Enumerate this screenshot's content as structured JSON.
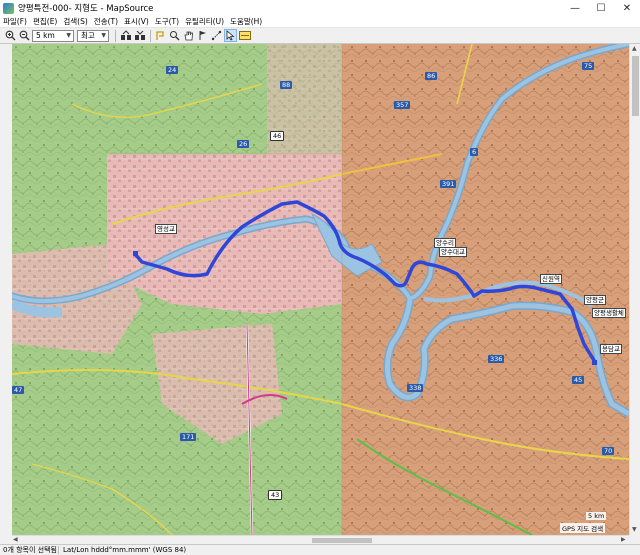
{
  "window": {
    "title": "양평특전-000- 지형도 - MapSource",
    "minimize_glyph": "—",
    "maximize_glyph": "☐",
    "close_glyph": "✕"
  },
  "menu": [
    {
      "label": "파일(F)"
    },
    {
      "label": "편집(E)"
    },
    {
      "label": "검색(S)"
    },
    {
      "label": "전송(T)"
    },
    {
      "label": "표시(V)"
    },
    {
      "label": "도구(T)"
    },
    {
      "label": "유틸리티(U)"
    },
    {
      "label": "도움말(H)"
    }
  ],
  "toolbar": {
    "zoom_level": "5 km",
    "detail_level": "최고",
    "icons": [
      "zoom-in-icon",
      "zoom-out-icon",
      "send-to-device-icon",
      "receive-from-device-icon",
      "route-tool-icon",
      "zoom-tool-icon",
      "hand-tool-icon",
      "flag-tool-icon",
      "measure-tool-icon",
      "select-tool-icon",
      "map-legend-icon"
    ]
  },
  "map": {
    "places": [
      {
        "label": "영성교"
      },
      {
        "label": "양수리"
      },
      {
        "label": "양수대교"
      },
      {
        "label": "신원역"
      },
      {
        "label": "양평군"
      },
      {
        "label": "양평생활체"
      },
      {
        "label": "용담교"
      }
    ],
    "road_shields": [
      "75",
      "88",
      "357",
      "86",
      "46",
      "26",
      "6",
      "391",
      "45",
      "336",
      "338",
      "70",
      "47",
      "171",
      "43",
      "24"
    ],
    "scale": "5 km",
    "attribution": "GPS 지도 검색",
    "route_color": "#3046d8"
  },
  "status": {
    "selection": "0개 항목이 선택됨",
    "coordinate_format": "Lat/Lon hddd°mm.mmm' (WGS 84)"
  }
}
